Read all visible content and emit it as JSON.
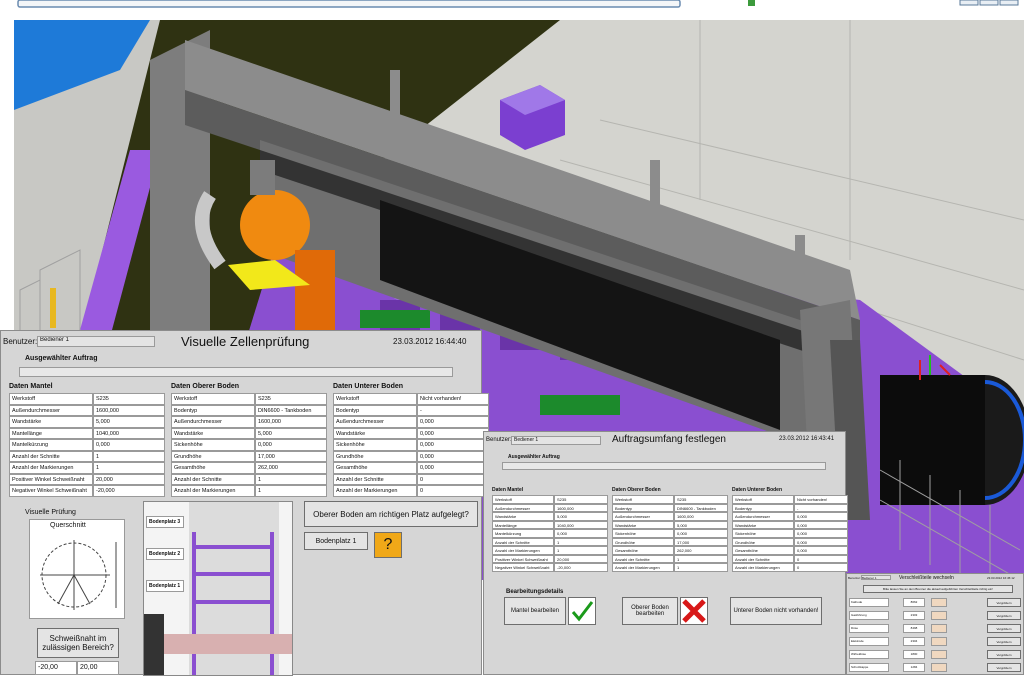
{
  "panel1": {
    "user_label": "Benutzer:",
    "user_value": "Bediener 1",
    "title": "Visuelle Zellenprüfung",
    "datetime": "23.03.2012 16:44:40",
    "selected_order_label": "Ausgewählter Auftrag",
    "selected_order_value": "",
    "sections": [
      {
        "header": "Daten Mantel",
        "rows": [
          [
            "Werkstoff",
            "S235"
          ],
          [
            "Außendurchmesser",
            "1600,000"
          ],
          [
            "Wandstärke",
            "5,000"
          ],
          [
            "Mantellänge",
            "1040,000"
          ],
          [
            "Mantelkürzung",
            "0,000"
          ],
          [
            "Anzahl der Schnitte",
            "1"
          ],
          [
            "Anzahl der Markierungen",
            "1"
          ],
          [
            "Positiver Winkel Schweißnaht",
            "20,000"
          ],
          [
            "Negativer Winkel Schweißnaht",
            "-20,000"
          ]
        ]
      },
      {
        "header": "Daten Oberer Boden",
        "rows": [
          [
            "Werkstoff",
            "S235"
          ],
          [
            "Bodentyp",
            "DIN6600 - Tankboden"
          ],
          [
            "Außendurchmesser",
            "1600,000"
          ],
          [
            "Wandstärke",
            "5,000"
          ],
          [
            "Sickenhöhe",
            "0,000"
          ],
          [
            "Grundhöhe",
            "17,000"
          ],
          [
            "Gesamthöhe",
            "262,000"
          ],
          [
            "Anzahl der Schnitte",
            "1"
          ],
          [
            "Anzahl der Markierungen",
            "1"
          ]
        ]
      },
      {
        "header": "Daten Unterer Boden",
        "rows": [
          [
            "Werkstoff",
            "Nicht vorhanden!"
          ],
          [
            "Bodentyp",
            "-"
          ],
          [
            "Außendurchmesser",
            "0,000"
          ],
          [
            "Wandstärke",
            "0,000"
          ],
          [
            "Sickenhöhe",
            "0,000"
          ],
          [
            "Grundhöhe",
            "0,000"
          ],
          [
            "Gesamthöhe",
            "0,000"
          ],
          [
            "Anzahl der Schnitte",
            "0"
          ],
          [
            "Anzahl der Markierungen",
            "0"
          ]
        ]
      }
    ],
    "visual_check_label": "Visuelle Prüfung",
    "cross_section_label": "Querschnitt",
    "weld_button": "Schweißnaht im zulässigen Bereich?",
    "weld_neg": "-20,00",
    "weld_pos": "20,00",
    "slots": [
      "Bodenplatz 3",
      "Bodenplatz 2",
      "Bodenplatz 1"
    ],
    "question_button": "Oberer Boden am richtigen Platz aufgelegt?",
    "slot_field": "Bodenplatz  1",
    "question_mark": "?"
  },
  "panel2": {
    "user_label": "Benutzer:",
    "user_value": "Bediener 1",
    "title": "Auftragsumfang festlegen",
    "datetime": "23.03.2012 16:43:41",
    "selected_order_label": "Ausgewählter Auftrag",
    "sections": [
      {
        "header": "Daten Mantel",
        "rows": [
          [
            "Werkstoff",
            "S235"
          ],
          [
            "Außendurchmesser",
            "1600,000"
          ],
          [
            "Wandstärke",
            "5,000"
          ],
          [
            "Mantellänge",
            "1040,000"
          ],
          [
            "Mantelkürzung",
            "0,000"
          ],
          [
            "Anzahl der Schnitte",
            "1"
          ],
          [
            "Anzahl der Markierungen",
            "1"
          ],
          [
            "Positiver Winkel Schweißnaht",
            "20,000"
          ],
          [
            "Negativer Winkel Schweißnaht",
            "-20,000"
          ]
        ]
      },
      {
        "header": "Daten Oberer Boden",
        "rows": [
          [
            "Werkstoff",
            "S235"
          ],
          [
            "Bodentyp",
            "DIN6600 - Tankboden"
          ],
          [
            "Außendurchmesser",
            "1600,000"
          ],
          [
            "Wandstärke",
            "5,000"
          ],
          [
            "Sickenhöhe",
            "0,000"
          ],
          [
            "Grundhöhe",
            "17,000"
          ],
          [
            "Gesamthöhe",
            "262,000"
          ],
          [
            "Anzahl der Schnitte",
            "1"
          ],
          [
            "Anzahl der Markierungen",
            "1"
          ]
        ]
      },
      {
        "header": "Daten Unterer Boden",
        "rows": [
          [
            "Werkstoff",
            "Nicht vorhanden!"
          ],
          [
            "Bodentyp",
            "-"
          ],
          [
            "Außendurchmesser",
            "0,000"
          ],
          [
            "Wandstärke",
            "0,000"
          ],
          [
            "Sickenhöhe",
            "0,000"
          ],
          [
            "Grundhöhe",
            "0,000"
          ],
          [
            "Gesamthöhe",
            "0,000"
          ],
          [
            "Anzahl der Schnitte",
            "0"
          ],
          [
            "Anzahl der Markierungen",
            "0"
          ]
        ]
      }
    ],
    "details_label": "Bearbeitungsdetails",
    "btn_mantel": "Mantel bearbeiten",
    "btn_oberer": "Oberer Boden bearbeiten",
    "btn_unterer": "Unterer Boden nicht  vorhanden!"
  },
  "panel3": {
    "user_label": "Benutzer:",
    "user_value": "Bediener 1",
    "title": "Verschleißteile wechseln",
    "datetime": "23.03.2012 16:45:12",
    "notice": "Bitte lassen Sie an dem Brenner die aktuell aufgeführten Verschleißteile richtig ein!",
    "items": [
      "Kathode",
      "Gasführung",
      "Düse",
      "Elektrode",
      "Wirbeldüse",
      "Schutzkappe"
    ],
    "values": [
      "8662",
      "2303",
      "8498",
      "2304",
      "1800",
      "1284"
    ],
    "button_label": "Vergrößern"
  },
  "colors": {
    "sky": "#2f3212",
    "purple": "#8a4fd0",
    "orange": "#f08a10",
    "ok_green": "#1a9a1a",
    "cancel_red": "#d81818",
    "question_bg": "#f0a818"
  }
}
